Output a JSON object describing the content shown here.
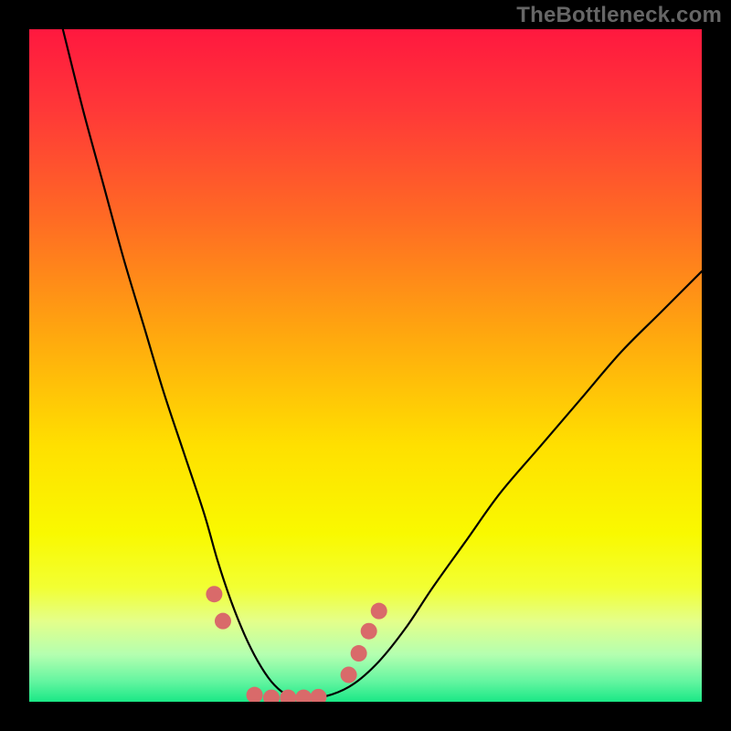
{
  "watermark": "TheBottleneck.com",
  "chart_data": {
    "type": "line",
    "title": "",
    "xlabel": "",
    "ylabel": "",
    "xlim": [
      0,
      100
    ],
    "ylim": [
      0,
      100
    ],
    "gradient": {
      "stops": [
        {
          "offset": 0.0,
          "color": "#ff183f"
        },
        {
          "offset": 0.12,
          "color": "#ff3838"
        },
        {
          "offset": 0.28,
          "color": "#ff6a24"
        },
        {
          "offset": 0.45,
          "color": "#ffa60f"
        },
        {
          "offset": 0.62,
          "color": "#ffe000"
        },
        {
          "offset": 0.75,
          "color": "#f9f900"
        },
        {
          "offset": 0.83,
          "color": "#f2ff33"
        },
        {
          "offset": 0.88,
          "color": "#e4ff8a"
        },
        {
          "offset": 0.93,
          "color": "#b4ffb0"
        },
        {
          "offset": 0.97,
          "color": "#63f5a0"
        },
        {
          "offset": 1.0,
          "color": "#1ae886"
        }
      ]
    },
    "series": [
      {
        "name": "bottleneck-curve",
        "x": [
          5,
          8,
          11,
          14,
          17,
          20,
          23,
          26,
          28,
          30,
          32,
          34,
          36,
          38,
          40,
          44,
          48,
          52,
          56,
          60,
          65,
          70,
          76,
          82,
          88,
          94,
          100
        ],
        "y": [
          100,
          88,
          77,
          66,
          56,
          46,
          37,
          28,
          21,
          15,
          10,
          6,
          3,
          1.2,
          0.5,
          0.8,
          2.5,
          6,
          11,
          17,
          24,
          31,
          38,
          45,
          52,
          58,
          64
        ]
      }
    ],
    "markers": {
      "name": "highlight-points",
      "color": "#d96a6a",
      "radius_px": 9,
      "points": [
        {
          "x": 27.5,
          "y": 16
        },
        {
          "x": 28.8,
          "y": 12
        },
        {
          "x": 33.5,
          "y": 1.0
        },
        {
          "x": 36.0,
          "y": 0.6
        },
        {
          "x": 38.5,
          "y": 0.6
        },
        {
          "x": 40.8,
          "y": 0.6
        },
        {
          "x": 43.0,
          "y": 0.7
        },
        {
          "x": 47.5,
          "y": 4.0
        },
        {
          "x": 49.0,
          "y": 7.2
        },
        {
          "x": 50.5,
          "y": 10.5
        },
        {
          "x": 52.0,
          "y": 13.5
        }
      ]
    }
  }
}
